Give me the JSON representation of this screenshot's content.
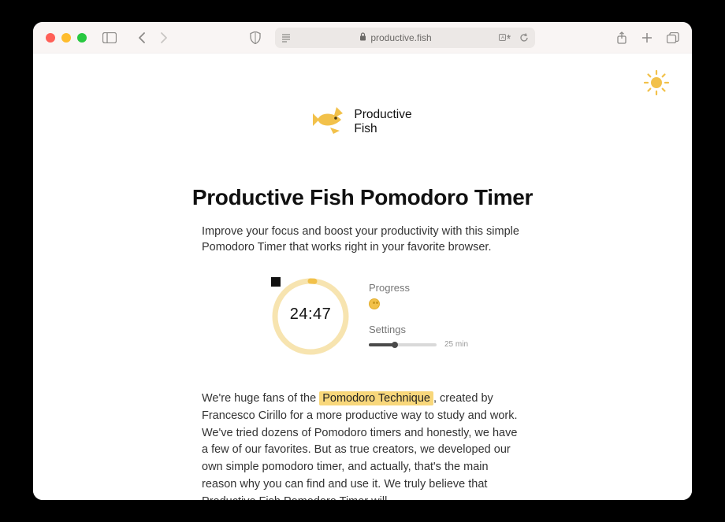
{
  "browser": {
    "url": "productive.fish"
  },
  "logo": {
    "line1": "Productive",
    "line2": "Fish"
  },
  "page_title": "Productive Fish Pomodoro Timer",
  "subheading": "Improve your focus and boost your productivity with this simple Pomodoro Timer that works right in your favorite browser.",
  "timer": {
    "display": "24:47"
  },
  "progress": {
    "label": "Progress"
  },
  "settings": {
    "label": "Settings",
    "duration_label": "25 min"
  },
  "body": {
    "prefix": "We're huge fans of the ",
    "highlight": "Pomodoro Technique",
    "rest": ", created by Francesco Cirillo for a more productive way to study and work. We've tried dozens of Pomodoro timers and honestly, we have a few of our favorites. But as true creators, we developed our own simple pomodoro timer, and actually, that's the main reason why you can find and use it. We truly believe that Productive Fish Pomodoro Timer will"
  }
}
